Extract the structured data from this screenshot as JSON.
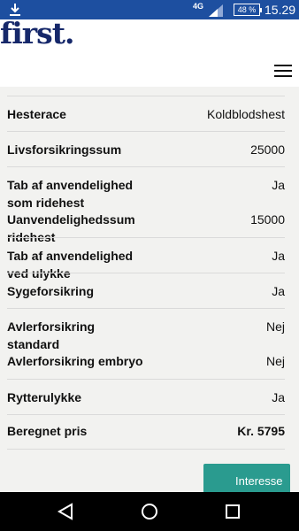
{
  "statusbar": {
    "network": "4G",
    "battery": "48 %",
    "time": "15.29"
  },
  "header": {
    "logo": "first."
  },
  "rows": [
    {
      "label": "Hesterace",
      "value": "Koldblodshest"
    },
    {
      "label": "Livsforsikringssum",
      "value": "25000"
    },
    {
      "label": "Tab af anvendelighed som ridehest",
      "value": "Ja"
    },
    {
      "label": "Uanvendelighedssum ridehest",
      "value": "15000"
    },
    {
      "label": "Tab af anvendelighed ved ulykke",
      "value": "Ja"
    },
    {
      "label": "Sygeforsikring",
      "value": "Ja"
    },
    {
      "label": "Avlerforsikring standard",
      "value": "Nej"
    },
    {
      "label": "Avlerforsikring embryo",
      "value": "Nej"
    },
    {
      "label": "Rytterulykke",
      "value": "Ja"
    },
    {
      "label": "Beregnet pris",
      "value": "Kr. 5795"
    }
  ],
  "actions": {
    "interest_label": "Interesse"
  }
}
